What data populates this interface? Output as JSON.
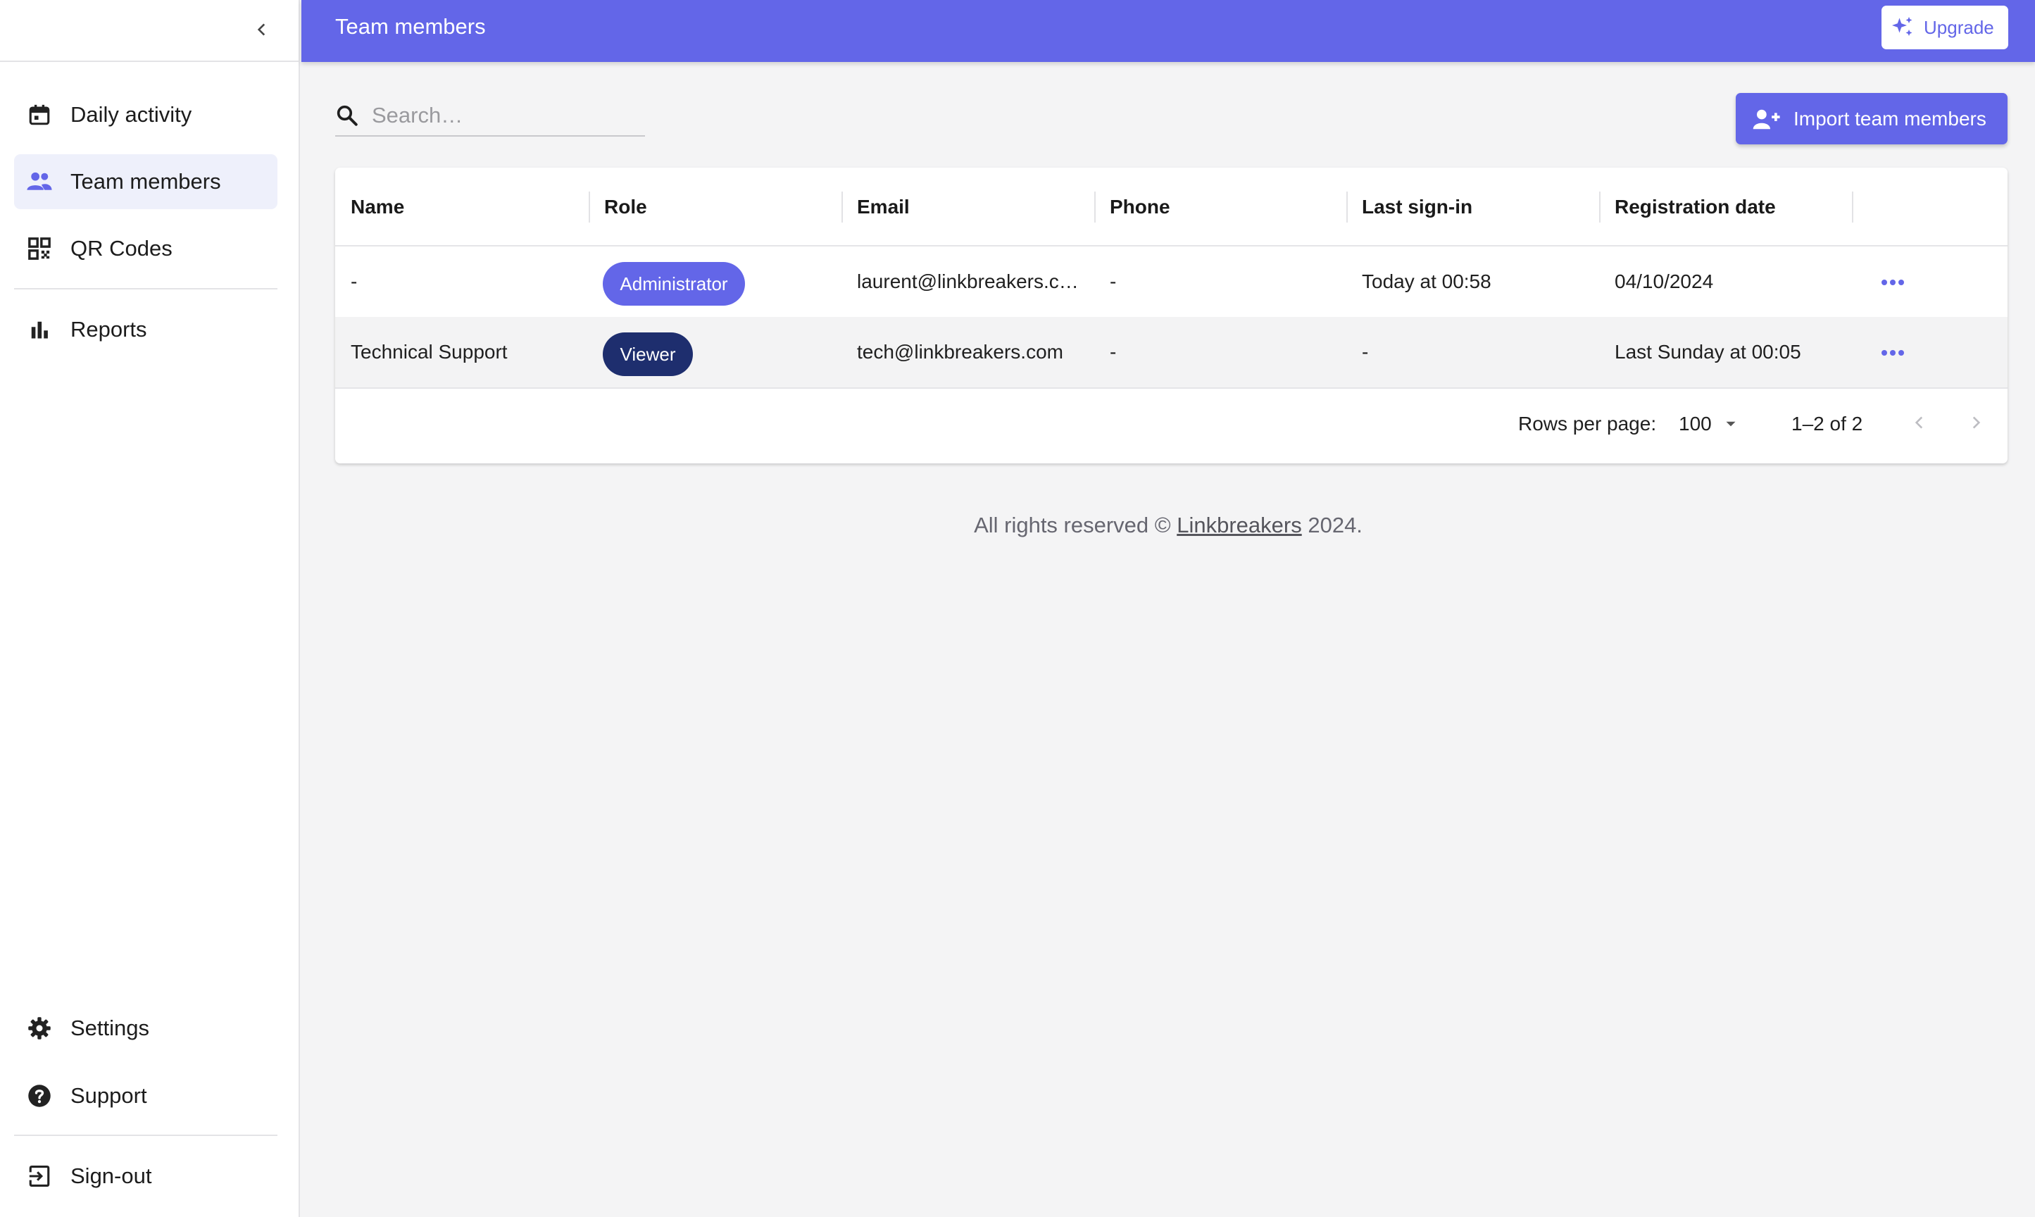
{
  "header": {
    "title": "Team members",
    "upgrade_label": "Upgrade"
  },
  "sidebar": {
    "items": [
      {
        "label": "Daily activity",
        "icon": "calendar-icon"
      },
      {
        "label": "Team members",
        "icon": "people-icon",
        "active": true
      },
      {
        "label": "QR Codes",
        "icon": "qr-code-icon"
      },
      {
        "label": "Reports",
        "icon": "bar-chart-icon"
      }
    ],
    "bottom_items": [
      {
        "label": "Settings",
        "icon": "gear-icon"
      },
      {
        "label": "Support",
        "icon": "help-icon"
      },
      {
        "label": "Sign-out",
        "icon": "sign-out-icon"
      }
    ]
  },
  "search": {
    "placeholder": "Search…",
    "value": ""
  },
  "toolbar": {
    "import_label": "Import team members"
  },
  "table": {
    "columns": [
      "Name",
      "Role",
      "Email",
      "Phone",
      "Last sign-in",
      "Registration date"
    ],
    "rows": [
      {
        "name": "-",
        "role": "Administrator",
        "email": "laurent@linkbreakers.c…",
        "phone": "-",
        "last_sign_in": "Today at 00:58",
        "registration_date": "04/10/2024"
      },
      {
        "name": "Technical Support",
        "role": "Viewer",
        "email": "tech@linkbreakers.com",
        "phone": "-",
        "last_sign_in": "-",
        "registration_date": "Last Sunday at 00:05"
      }
    ],
    "role_colors": {
      "Administrator": "#6366e8",
      "Viewer": "#1e2e6e"
    }
  },
  "pagination": {
    "rows_per_page_label": "Rows per page:",
    "rows_per_page": "100",
    "range": "1–2 of 2"
  },
  "footer": {
    "prefix": "All rights reserved ©",
    "link": "Linkbreakers",
    "suffix": "2024."
  },
  "colors": {
    "accent": "#6366e8",
    "background": "#f4f4f5"
  }
}
